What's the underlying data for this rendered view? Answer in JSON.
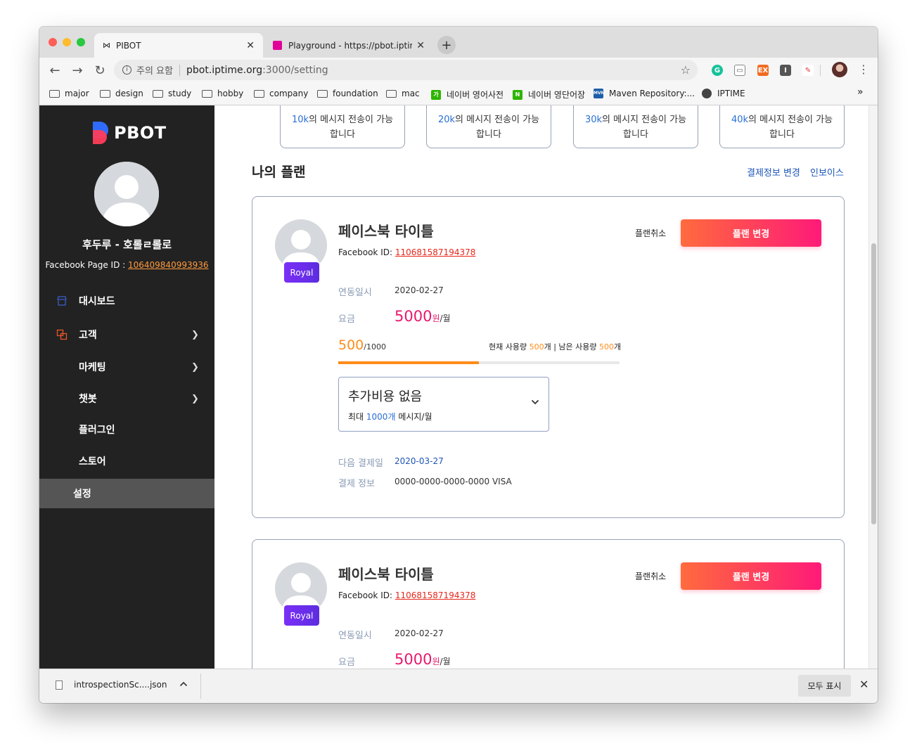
{
  "browser": {
    "tabs": [
      {
        "title": "PIBOT",
        "close": "✕"
      },
      {
        "title": "Playground - https://pbot.iptime.org",
        "close": "✕"
      }
    ],
    "new_tab": "+",
    "address": {
      "security_label": "주의 요함",
      "host": "pbot.iptime.org",
      "path": ":3000/setting"
    },
    "bookmarks": [
      {
        "label": "major"
      },
      {
        "label": "design"
      },
      {
        "label": "study"
      },
      {
        "label": "hobby"
      },
      {
        "label": "company"
      },
      {
        "label": "foundation"
      },
      {
        "label": "mac"
      },
      {
        "label": "네이버 영어사전",
        "icon_text": "가",
        "icon_color": "#2db400"
      },
      {
        "label": "네이버 영단어장",
        "icon_text": "N",
        "icon_color": "#2db400"
      },
      {
        "label": "Maven Repository:...",
        "icon_text": "MVN",
        "icon_color": "#1d5fa8"
      },
      {
        "label": "IPTIME"
      }
    ],
    "bookmarks_overflow": "»"
  },
  "sidebar": {
    "logo_text": "PBOT",
    "profile_name": "후두루 - 호롤ㄹ롤로",
    "page_id_label": "Facebook Page ID : ",
    "page_id_value": "106409840993936",
    "menu": [
      {
        "label": "대시보드",
        "has_children": false,
        "icon": "store-icon"
      },
      {
        "label": "고객",
        "has_children": true,
        "icon": "customers-icon"
      },
      {
        "label": "마케팅",
        "has_children": true
      },
      {
        "label": "챗봇",
        "has_children": true
      },
      {
        "label": "플러그인",
        "has_children": false
      },
      {
        "label": "스토어",
        "has_children": false
      },
      {
        "label": "설정",
        "has_children": false,
        "active": true
      }
    ]
  },
  "tiers": [
    {
      "qty": "10k",
      "text": "의 메시지 전송이 가능",
      "text2": "합니다"
    },
    {
      "qty": "20k",
      "text": "의 메시지 전송이 가능",
      "text2": "합니다"
    },
    {
      "qty": "30k",
      "text": "의 메시지 전송이 가능",
      "text2": "합니다"
    },
    {
      "qty": "40k",
      "text": "의 메시지 전송이 가능",
      "text2": "합니다"
    }
  ],
  "my_plan": {
    "title": "나의 플랜",
    "billing_link": "결제정보 변경",
    "invoice_link": "인보이스"
  },
  "plans": [
    {
      "badge": "Royal",
      "title": "페이스북 타이틀",
      "fb_id_label": "Facebook ID: ",
      "fb_id": "110681587194378",
      "cancel": "플랜취소",
      "change": "플랜 변경",
      "linked_label": "연동일시",
      "linked_date": "2020-02-27",
      "price_label": "요금",
      "price": "5000",
      "price_unit": "원",
      "price_period": "/월",
      "usage_current": "500",
      "usage_max": "/1000",
      "usage_fraction": 0.5,
      "usage_text_1": "현재 사용량 ",
      "usage_used": "500",
      "usage_text_2": "개 | 남은 사용량 ",
      "usage_left": "500",
      "usage_text_3": "개",
      "addon_title": "추가비용 없음",
      "addon_sub_1": "최대 ",
      "addon_sub_max": "1000개",
      "addon_sub_2": " 메시지/월",
      "next_label": "다음 결제일",
      "next_date": "2020-03-27",
      "pay_label": "결제 정보",
      "pay_info": "0000-0000-0000-0000 VISA"
    },
    {
      "badge": "Royal",
      "title": "페이스북 타이틀",
      "fb_id_label": "Facebook ID: ",
      "fb_id": "110681587194378",
      "cancel": "플랜취소",
      "change": "플랜 변경",
      "linked_label": "연동일시",
      "linked_date": "2020-02-27",
      "price_label": "요금",
      "price": "5000",
      "price_unit": "원",
      "price_period": "/월"
    }
  ],
  "downloads": {
    "file": "introspectionSc....json",
    "show_all": "모두 표시",
    "close": "✕"
  }
}
